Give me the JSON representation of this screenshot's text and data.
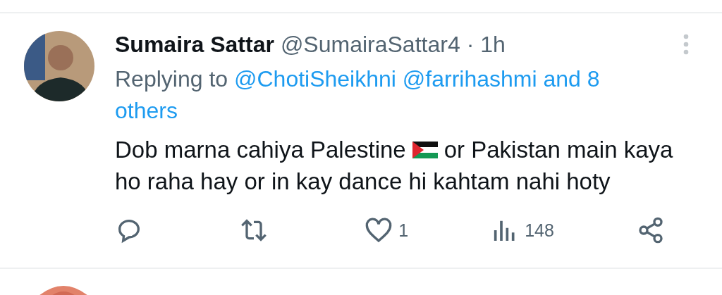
{
  "tweet": {
    "author": "Sumaira Sattar",
    "handle": "@SumairaSattar4",
    "time": "· 1h",
    "replying_prefix": "Replying to",
    "replying_to": [
      "@ChotiSheikhni",
      "@farrihashmi",
      "and 8"
    ],
    "replying_continued": "others",
    "body_before_flag": "Dob marna cahiya Palestine",
    "body_after_flag": "or Pakistan main kaya",
    "body_second_line": "ho raha hay or in kay dance hi kahtam nahi hoty",
    "actions": [
      {
        "kind": "reply"
      },
      {
        "kind": "repost"
      },
      {
        "kind": "like",
        "count": "1"
      },
      {
        "kind": "views",
        "count": "148"
      },
      {
        "kind": "share"
      }
    ]
  }
}
